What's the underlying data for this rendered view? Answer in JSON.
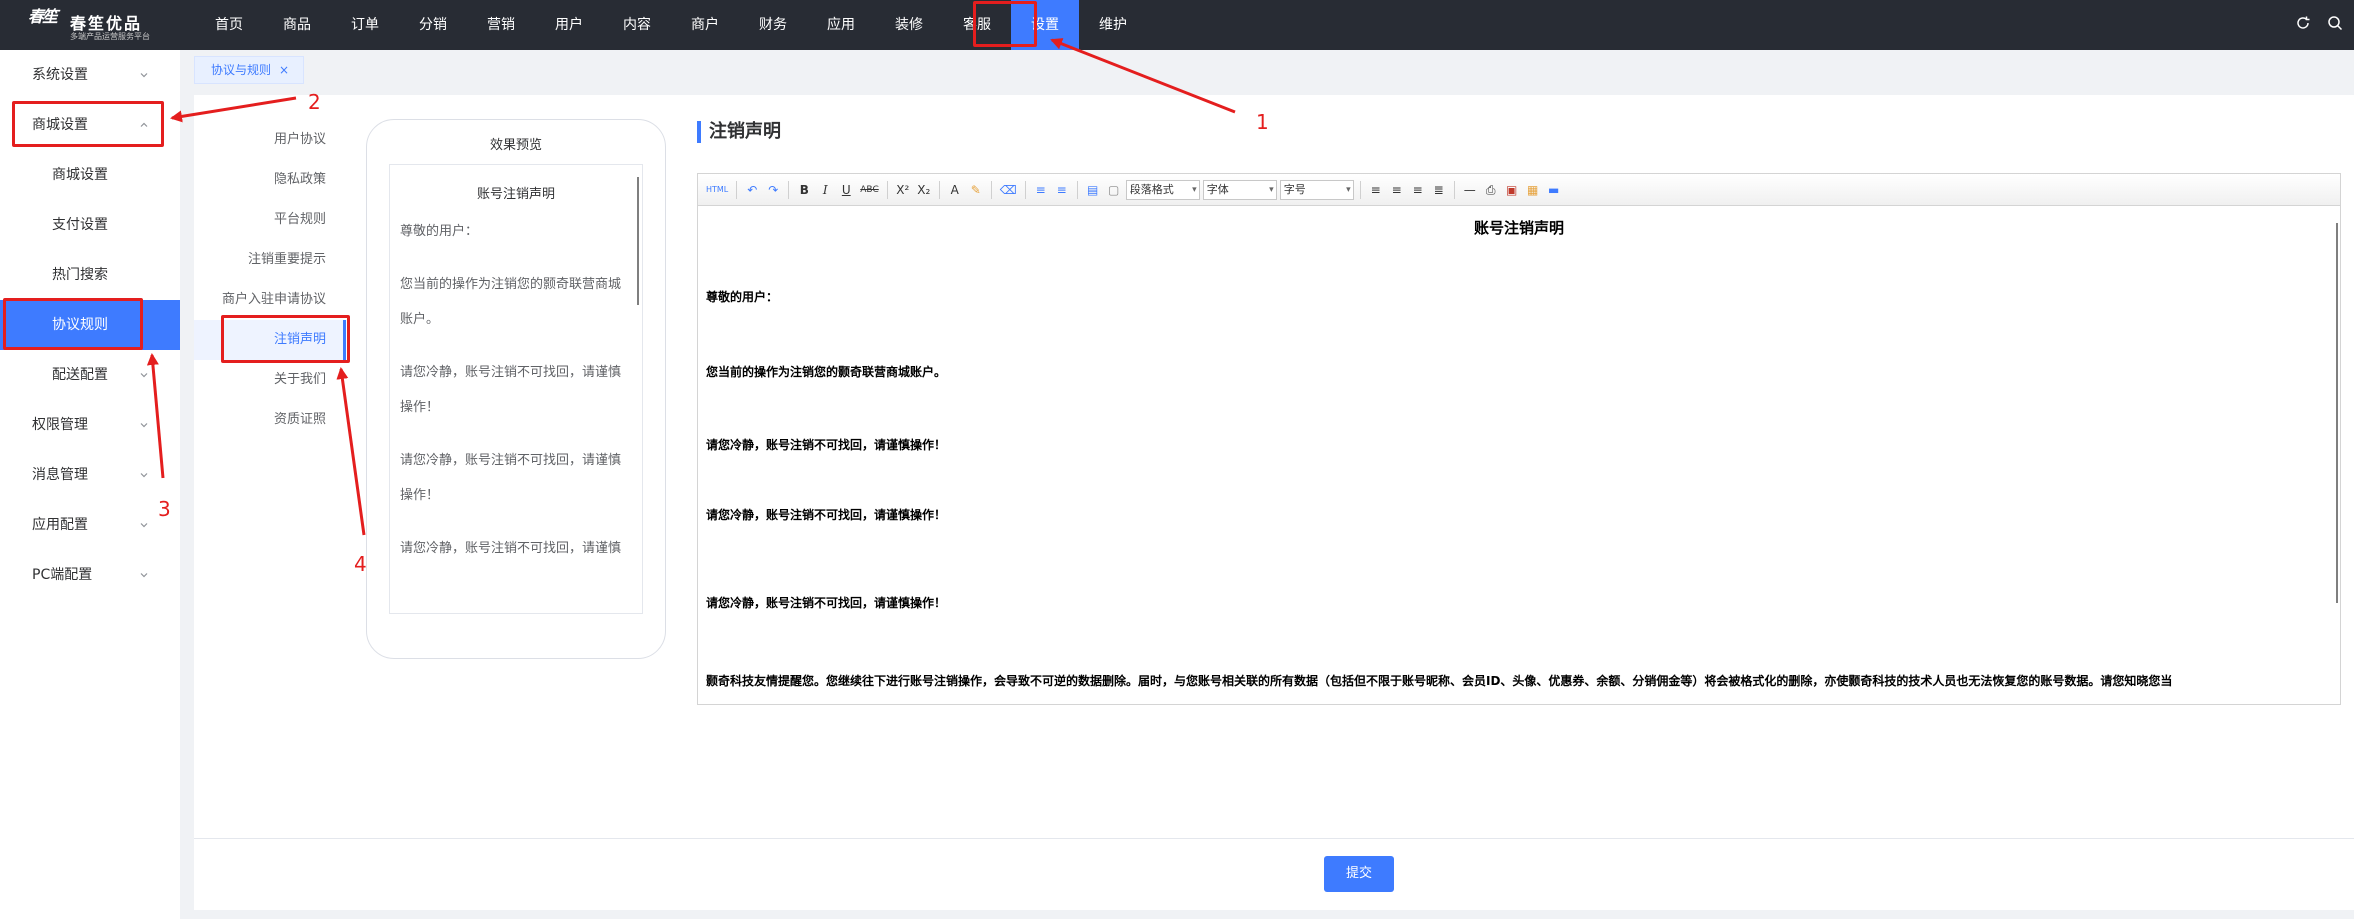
{
  "brand": {
    "mark": "春笙",
    "name": "春笙优品",
    "slogan": "多端产品运营服务平台"
  },
  "topnav": {
    "items": [
      {
        "label": "首页"
      },
      {
        "label": "商品"
      },
      {
        "label": "订单"
      },
      {
        "label": "分销"
      },
      {
        "label": "营销"
      },
      {
        "label": "用户"
      },
      {
        "label": "内容"
      },
      {
        "label": "商户"
      },
      {
        "label": "财务"
      },
      {
        "label": "应用"
      },
      {
        "label": "装修"
      },
      {
        "label": "客服"
      },
      {
        "label": "设置",
        "active": true
      },
      {
        "label": "维护"
      }
    ],
    "right_icons": [
      "refresh-icon",
      "search-icon"
    ]
  },
  "sidebar": {
    "items": [
      {
        "label": "系统设置"
      },
      {
        "label": "商城设置"
      },
      {
        "label": "商城设置"
      },
      {
        "label": "支付设置"
      },
      {
        "label": "热门搜索"
      },
      {
        "label": "协议规则"
      },
      {
        "label": "配送配置"
      },
      {
        "label": "权限管理"
      },
      {
        "label": "消息管理"
      },
      {
        "label": "应用配置"
      },
      {
        "label": "PC端配置"
      }
    ]
  },
  "tabs": [
    {
      "label": "协议与规则",
      "close": "×"
    }
  ],
  "agreements": {
    "items": [
      {
        "label": "用户协议"
      },
      {
        "label": "隐私政策"
      },
      {
        "label": "平台规则"
      },
      {
        "label": "注销重要提示"
      },
      {
        "label": "商户入驻申请协议"
      },
      {
        "label": "注销声明"
      },
      {
        "label": "关于我们"
      },
      {
        "label": "资质证照"
      }
    ]
  },
  "preview": {
    "title": "效果预览",
    "heading": "账号注销声明",
    "paragraphs": [
      "尊敬的用户：",
      "您当前的操作为注销您的颢奇联营商城账户。",
      "请您冷静，账号注销不可找回，请谨慎操作！",
      "请您冷静，账号注销不可找回，请谨慎操作！",
      "请您冷静，账号注销不可找回，请谨慎"
    ]
  },
  "editor": {
    "section_title": "注销声明",
    "toolbar": {
      "html": "HTML",
      "undo": "↶",
      "redo": "↷",
      "bold": "B",
      "italic": "I",
      "underline": "U",
      "strike": "ABC",
      "sup": "X²",
      "sub": "X₂",
      "font_color": "A",
      "highlight": "✎",
      "eraser": "⌫",
      "ol": "≡",
      "ul": "≡",
      "para_select": "段落格式",
      "font_select": "字体",
      "size_select": "字号"
    },
    "heading": "账号注销声明",
    "paragraphs": [
      "尊敬的用户：",
      "您当前的操作为注销您的颢奇联营商城账户。",
      "请您冷静，账号注销不可找回，请谨慎操作！",
      "请您冷静，账号注销不可找回，请谨慎操作！",
      "请您冷静，账号注销不可找回，请谨慎操作！",
      "颢奇科技友情提醒您。您继续往下进行账号注销操作，会导致不可逆的数据删除。届时，与您账号相关联的所有数据（包括但不限于账号昵称、会员ID、头像、优惠券、余额、分销佣金等）将会被格式化的删除，亦使颢奇科技的技术人员也无法恢复您的账号数据。请您知晓您当"
    ]
  },
  "footer": {
    "submit_label": "提交"
  },
  "annotations": {
    "numbers": [
      "1",
      "2",
      "3",
      "4"
    ],
    "color": "#e41e1e"
  },
  "colors": {
    "topbar": "#282c34",
    "accent": "#3e7bff",
    "annotation": "#e41e1e"
  }
}
